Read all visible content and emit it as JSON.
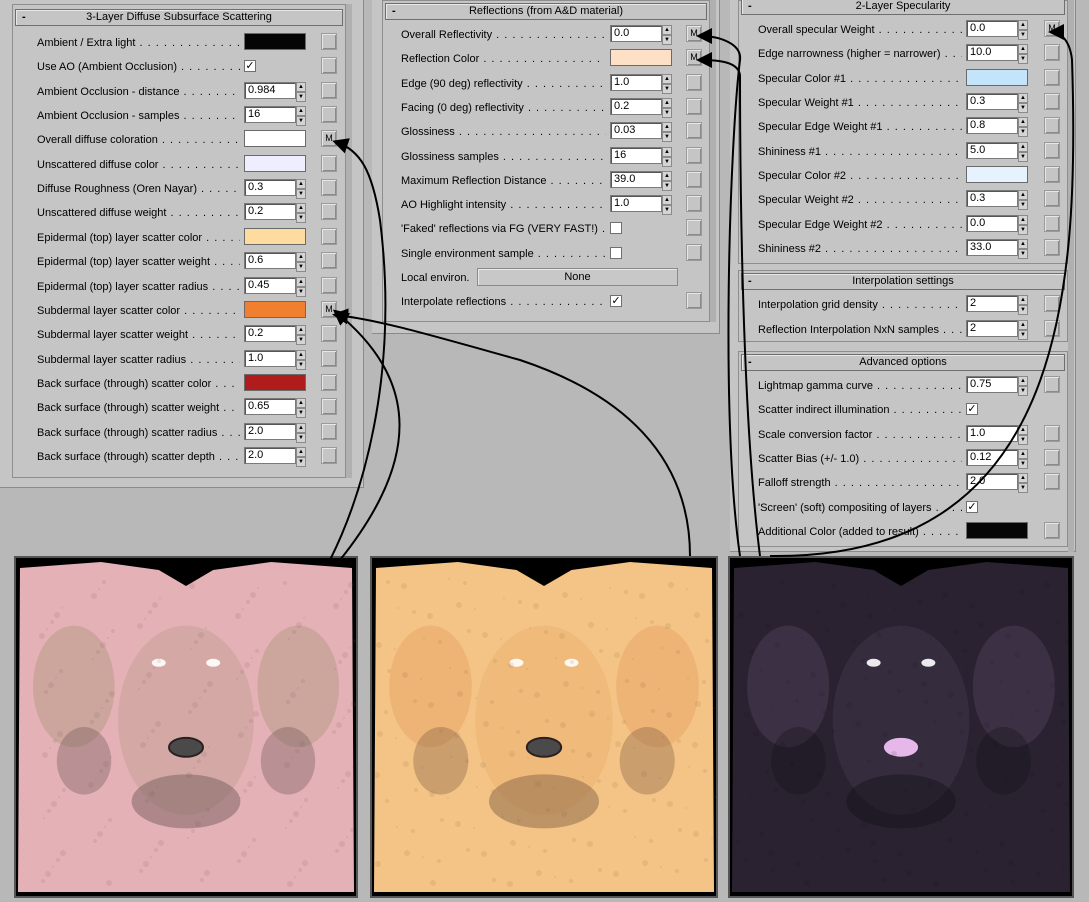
{
  "left_panel": {
    "title": "3-Layer Diffuse Subsurface Scattering",
    "rows": [
      {
        "label": "Ambient / Extra light",
        "type": "color",
        "color": "#050505"
      },
      {
        "label": "Use AO (Ambient Occlusion)",
        "type": "check",
        "checked": "✓"
      },
      {
        "label": "Ambient Occlusion - distance",
        "type": "spin",
        "value": "0.984"
      },
      {
        "label": "Ambient Occlusion - samples",
        "type": "spin",
        "value": "16"
      },
      {
        "label": "Overall diffuse coloration",
        "type": "color",
        "color": "#ffffff",
        "map": "M"
      },
      {
        "label": "Unscattered diffuse color",
        "type": "color",
        "color": "#eeeeff"
      },
      {
        "label": "Diffuse Roughness (Oren Nayar)",
        "type": "spin",
        "value": "0.3"
      },
      {
        "label": "Unscattered diffuse weight",
        "type": "spin",
        "value": "0.2"
      },
      {
        "label": "Epidermal (top) layer scatter color",
        "type": "color",
        "color": "#fedca0"
      },
      {
        "label": "Epidermal (top) layer scatter weight",
        "type": "spin",
        "value": "0.6"
      },
      {
        "label": "Epidermal (top) layer scatter radius",
        "type": "spin",
        "value": "0.45"
      },
      {
        "label": "Subdermal layer scatter color",
        "type": "color",
        "color": "#f08030",
        "map": "M"
      },
      {
        "label": "Subdermal layer scatter weight",
        "type": "spin",
        "value": "0.2"
      },
      {
        "label": "Subdermal layer scatter radius",
        "type": "spin",
        "value": "1.0"
      },
      {
        "label": "Back surface (through) scatter color",
        "type": "color",
        "color": "#b01c1c"
      },
      {
        "label": "Back surface (through) scatter weight",
        "type": "spin",
        "value": "0.65"
      },
      {
        "label": "Back surface (through) scatter radius",
        "type": "spin",
        "value": "2.0"
      },
      {
        "label": "Back surface (through) scatter depth",
        "type": "spin",
        "value": "2.0"
      }
    ]
  },
  "mid_panel": {
    "title": "Reflections (from A&D material)",
    "rows": [
      {
        "label": "Overall Reflectivity",
        "type": "spin",
        "value": "0.0",
        "map": "M"
      },
      {
        "label": "Reflection Color",
        "type": "color",
        "color": "#fde0c6",
        "map": "M"
      },
      {
        "label": "Edge (90 deg) reflectivity",
        "type": "spin",
        "value": "1.0"
      },
      {
        "label": "Facing (0 deg) reflectivity",
        "type": "spin",
        "value": "0.2"
      },
      {
        "label": "Glossiness",
        "type": "spin",
        "value": "0.03"
      },
      {
        "label": "Glossiness samples",
        "type": "spin",
        "value": "16"
      },
      {
        "label": "Maximum Reflection Distance",
        "type": "spin",
        "value": "39.0"
      },
      {
        "label": "AO Highlight intensity",
        "type": "spin",
        "value": "1.0"
      },
      {
        "label": "'Faked' reflections via FG (VERY FAST!)",
        "type": "check",
        "checked": ""
      },
      {
        "label": "Single environment sample",
        "type": "check",
        "checked": ""
      },
      {
        "label": "Local environ.",
        "type": "button",
        "value": "None"
      },
      {
        "label": "Interpolate reflections",
        "type": "check",
        "checked": "✓"
      }
    ]
  },
  "right_panel": {
    "title": "2-Layer Specularity",
    "rows": [
      {
        "label": "Overall specular Weight",
        "type": "spin",
        "value": "0.0",
        "map": "M"
      },
      {
        "label": "Edge narrowness (higher = narrower)",
        "type": "spin",
        "value": "10.0"
      },
      {
        "label": "Specular Color #1",
        "type": "color",
        "color": "#c4e4fc"
      },
      {
        "label": "Specular Weight #1",
        "type": "spin",
        "value": "0.3"
      },
      {
        "label": "Specular Edge Weight #1",
        "type": "spin",
        "value": "0.8"
      },
      {
        "label": "Shininess #1",
        "type": "spin",
        "value": "5.0"
      },
      {
        "label": "Specular Color #2",
        "type": "color",
        "color": "#e6f2fe"
      },
      {
        "label": "Specular Weight #2",
        "type": "spin",
        "value": "0.3"
      },
      {
        "label": "Specular Edge Weight #2",
        "type": "spin",
        "value": "0.0"
      },
      {
        "label": "Shininess #2",
        "type": "spin",
        "value": "33.0"
      }
    ]
  },
  "interp_panel": {
    "title": "Interpolation settings",
    "rows": [
      {
        "label": "Interpolation grid density",
        "type": "spin",
        "value": "2"
      },
      {
        "label": "Reflection Interpolation NxN samples",
        "type": "spin",
        "value": "2"
      }
    ]
  },
  "adv_panel": {
    "title": "Advanced options",
    "rows": [
      {
        "label": "Lightmap gamma curve",
        "type": "spin",
        "value": "0.75"
      },
      {
        "label": "Scatter indirect illumination",
        "type": "check",
        "checked": "✓"
      },
      {
        "label": "Scale conversion factor",
        "type": "spin",
        "value": "1.0"
      },
      {
        "label": "Scatter Bias (+/- 1.0)",
        "type": "spin",
        "value": "0.12"
      },
      {
        "label": "Falloff strength",
        "type": "spin",
        "value": "2.0"
      },
      {
        "label": "'Screen' (soft) compositing of layers",
        "type": "check",
        "checked": "✓"
      },
      {
        "label": "Additional Color (added to result)",
        "type": "color",
        "color": "#050505"
      }
    ]
  },
  "textures": [
    {
      "name": "diffuse-texture",
      "base": "#e4b1b6",
      "accent": "#b89a88",
      "dark": "#6a5555"
    },
    {
      "name": "reflection-texture",
      "base": "#f4c486",
      "accent": "#e8a868",
      "dark": "#7a5a40"
    },
    {
      "name": "specular-texture",
      "base": "#2a2230",
      "accent": "#4a3e55",
      "dark": "#15121a"
    }
  ],
  "ui_colors": {
    "panel_bg": "#c5c5c5",
    "field_bg": "#ffffff",
    "desktop_bg": "#b8b8b8"
  }
}
